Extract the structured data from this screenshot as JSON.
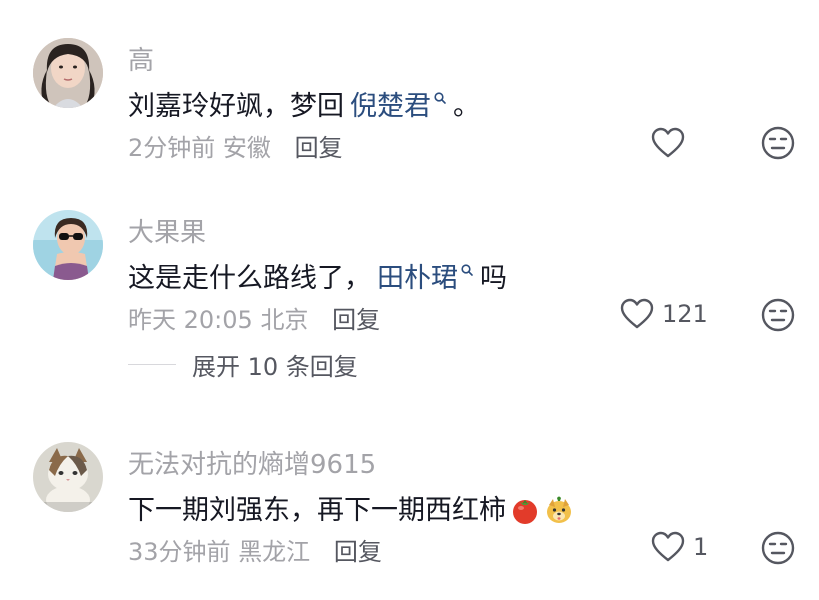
{
  "comments": [
    {
      "username": "高",
      "text_before": "刘嘉玲好飒，梦回",
      "mention": "倪楚君",
      "text_after": "。",
      "time": "2分钟前",
      "location": "安徽",
      "reply_label": "回复",
      "like_count": "",
      "avatar_icon": "avatar-woman-portrait"
    },
    {
      "username": "大果果",
      "text_before": "这是走什么路线了，",
      "mention": "田朴珺",
      "text_after": "吗",
      "time": "昨天 20:05",
      "location": "北京",
      "reply_label": "回复",
      "like_count": "121",
      "avatar_icon": "avatar-woman-sunglasses"
    },
    {
      "username": "无法对抗的熵增9615",
      "text_before": "下一期刘强东，再下一期西红柿",
      "mention": "",
      "text_after": "",
      "time": "33分钟前",
      "location": "黑龙江",
      "reply_label": "回复",
      "like_count": "1",
      "avatar_icon": "avatar-cat"
    }
  ],
  "expand_replies_label": "展开 10 条回复",
  "icons": {
    "like": "heart-outline-icon",
    "dislike": "neutral-face-icon",
    "mention": "search-icon",
    "emoji_1": "tomato-emoji",
    "emoji_2": "dog-face-emoji"
  },
  "colors": {
    "text": "#161823",
    "secondary": "#a3a3a8",
    "mention": "#2b4d7e",
    "action": "#555760"
  }
}
